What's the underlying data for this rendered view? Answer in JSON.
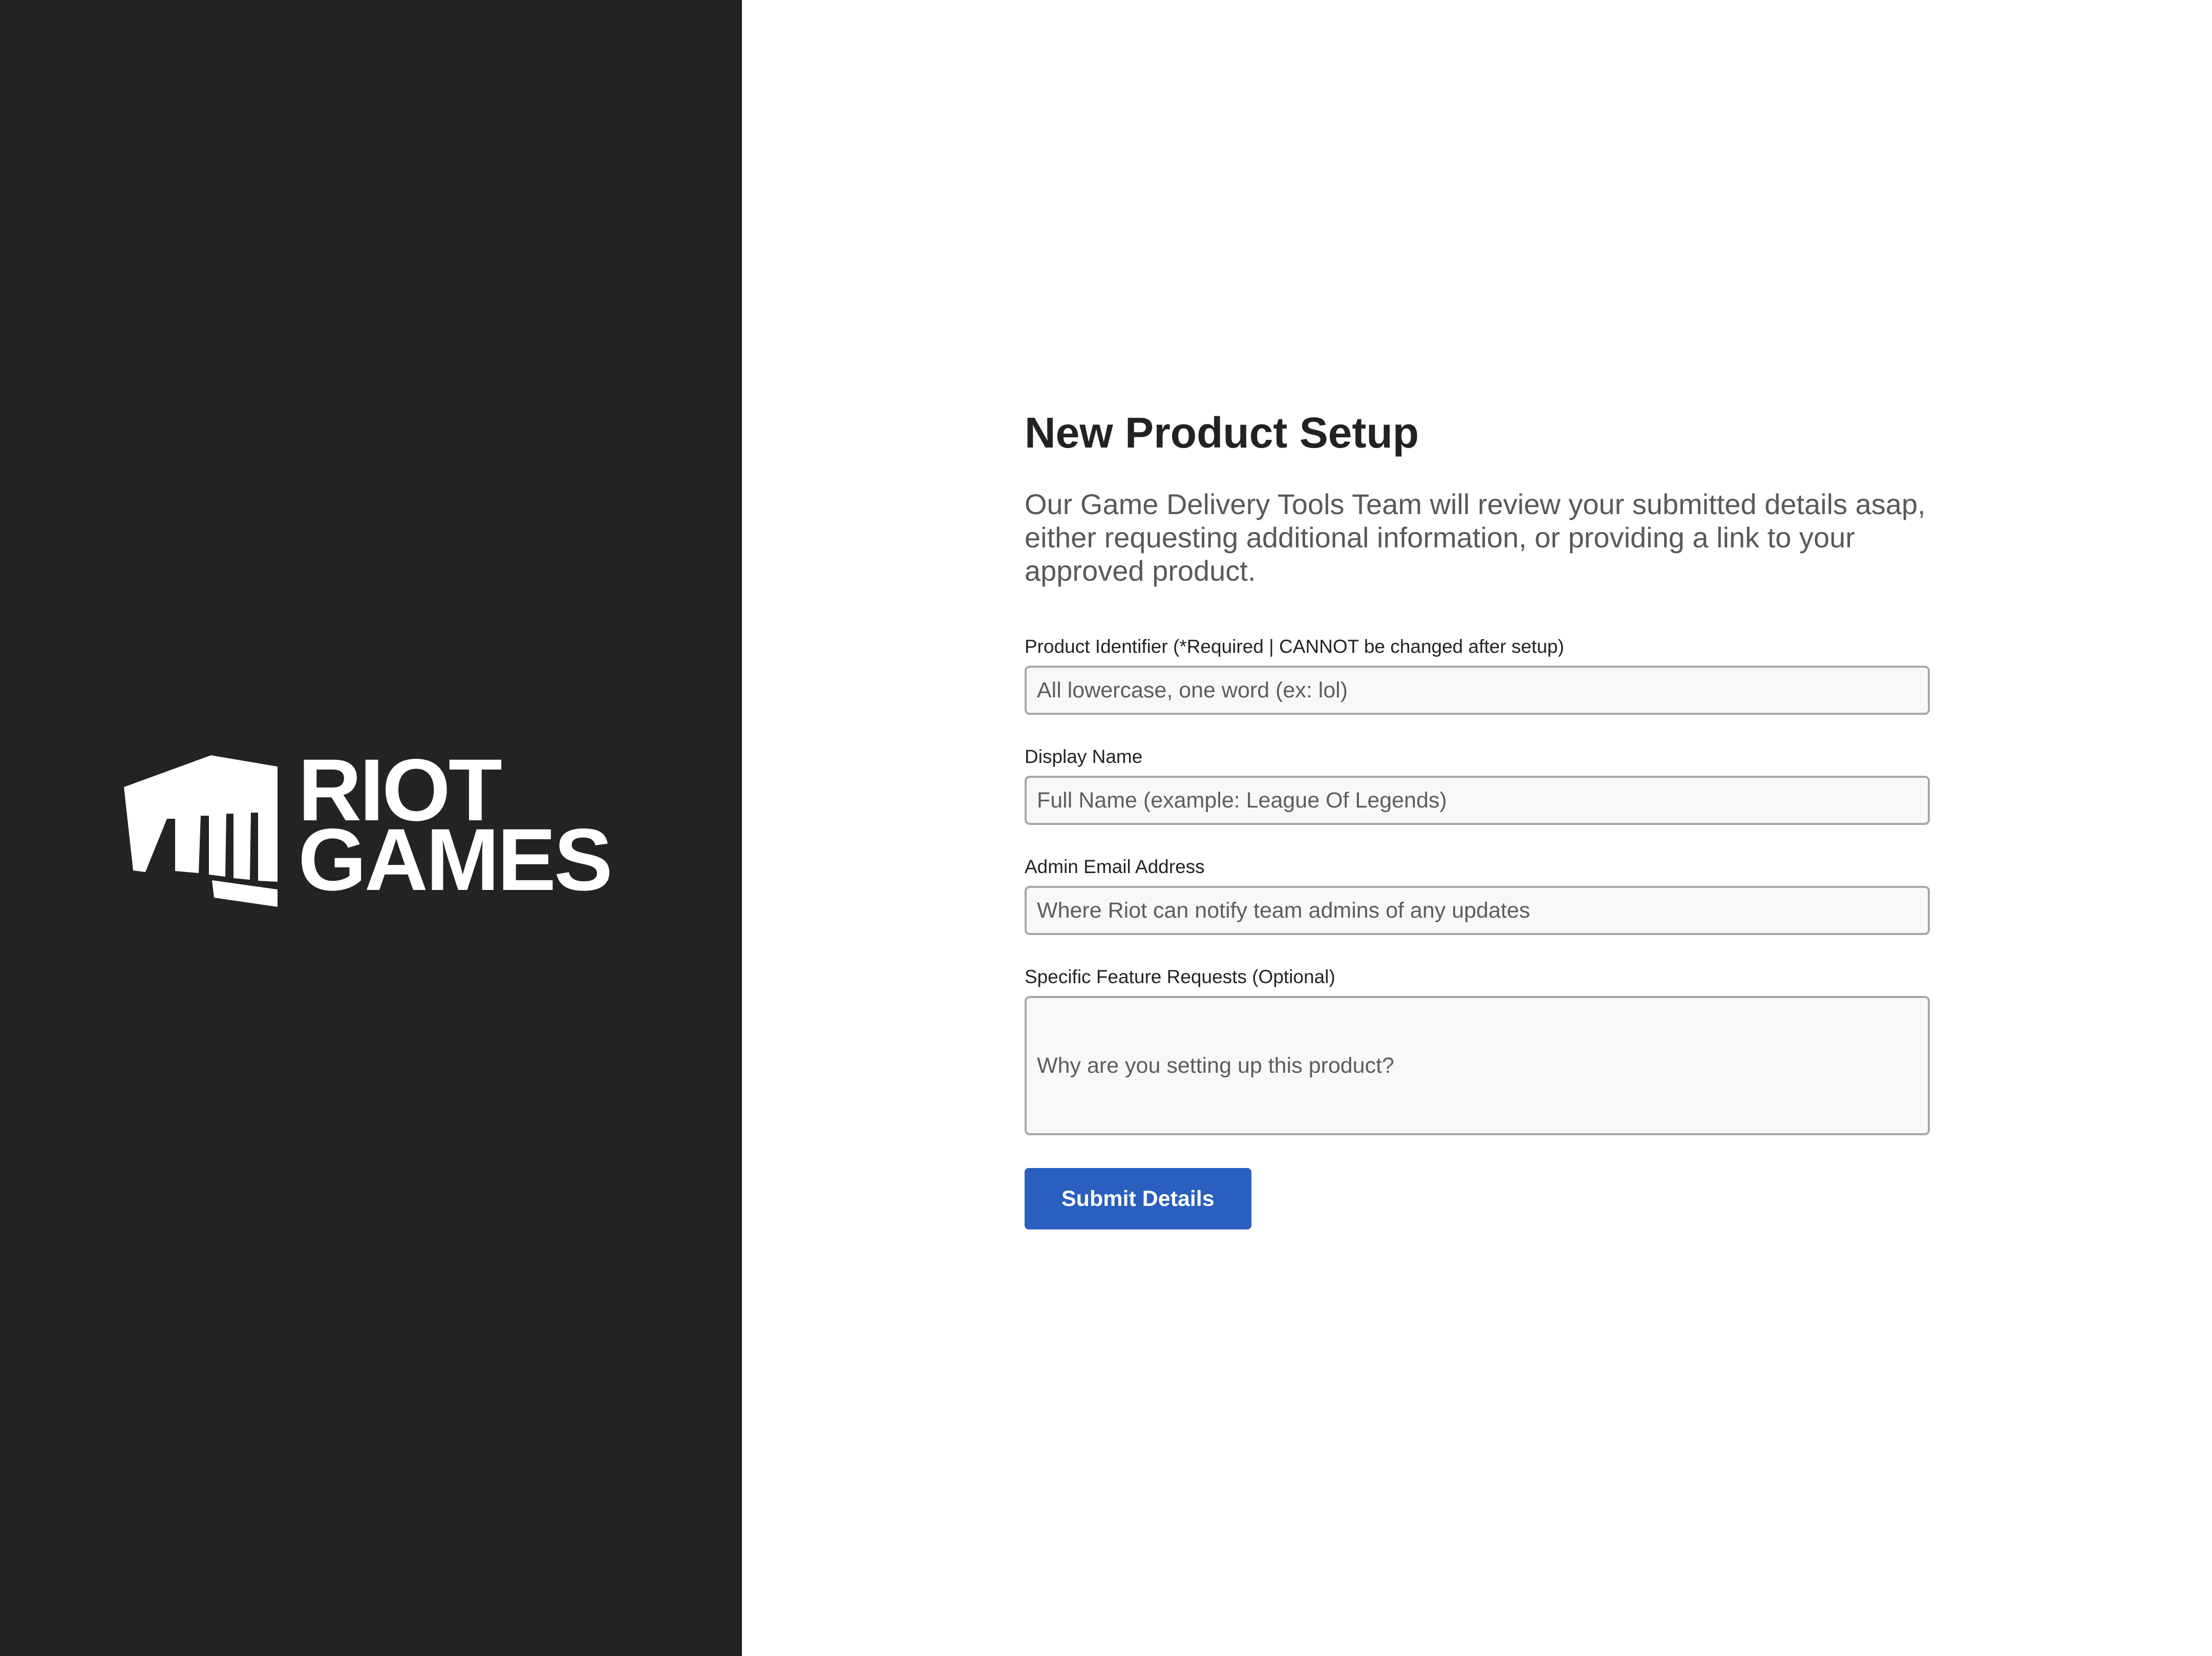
{
  "brand": {
    "logo_line1": "RIOT",
    "logo_line2": "GAMES",
    "panel_color": "#222325",
    "logo_icon": "riot-fist-icon"
  },
  "form": {
    "title": "New Product Setup",
    "intro": "Our Game Delivery Tools Team will review your submitted details asap, either requesting additional information, or providing a link to your approved product.",
    "fields": [
      {
        "label": "Product Identifier (*Required | CANNOT be changed after setup)",
        "placeholder": "All lowercase, one word (ex: lol)",
        "value": ""
      },
      {
        "label": "Display Name",
        "placeholder": "Full Name (example: League Of Legends)",
        "value": ""
      },
      {
        "label": "Admin Email Address",
        "placeholder": "Where Riot can notify team admins of any updates",
        "value": ""
      },
      {
        "label": "Specific Feature Requests (Optional)",
        "placeholder": "Why are you setting up this product?",
        "value": ""
      }
    ],
    "submit_label": "Submit Details",
    "accent_color": "#2a5fbf"
  }
}
